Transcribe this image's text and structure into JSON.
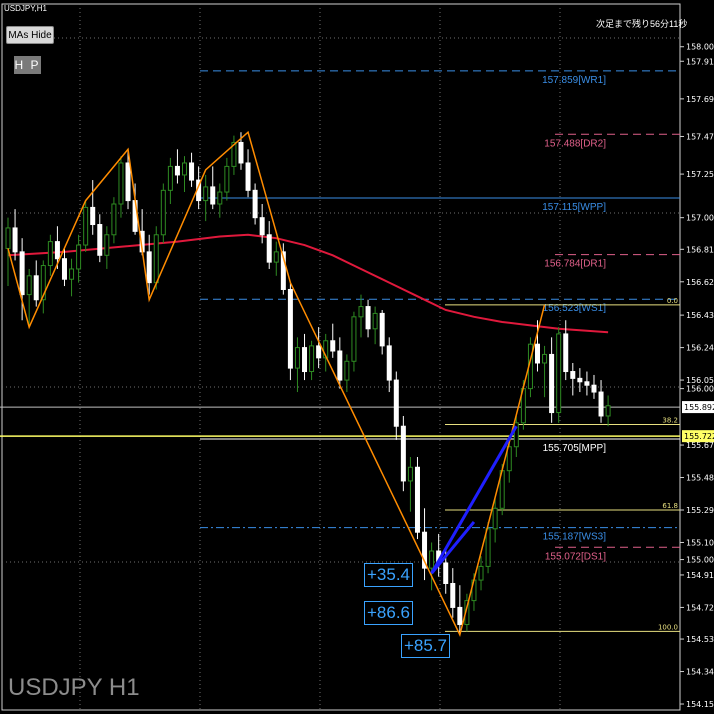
{
  "header": {
    "symbol_title": "USDJPY,H1",
    "countdown": "次足まで残り56分11秒",
    "watermark": "USDJPY H1",
    "mas_hide_label": "MAs Hide",
    "hp_label": "H P"
  },
  "gain_labels": [
    "+35.4",
    "+86.6",
    "+85.7"
  ],
  "colors": {
    "background": "#000000",
    "bull_candle": "#2e8b22",
    "bear_candle": "#ffffff",
    "moving_average": "#e0193c",
    "zigzag": "#ff8c00",
    "blue_trendlines": "#1f1fff",
    "pivot_blue": "#3a8ee6",
    "pivot_pink": "#e0608a",
    "current_price": "#ffff66"
  },
  "chart_data": {
    "type": "candlestick",
    "symbol": "USDJPY",
    "timeframe": "H1",
    "y_range": [
      154.12,
      158.25
    ],
    "y_ticks": [
      "158.000",
      "157.915",
      "157.695",
      "157.475",
      "157.255",
      "157.000",
      "156.815",
      "156.625",
      "156.430",
      "156.240",
      "156.050",
      "156.000",
      "155.670",
      "155.480",
      "155.290",
      "155.100",
      "155.000",
      "154.910",
      "154.720",
      "154.535",
      "154.345",
      "154.155"
    ],
    "price_marks": [
      {
        "text": "155.892",
        "kind": "bid"
      },
      {
        "text": "155.722",
        "kind": "current"
      }
    ],
    "pivot_levels": [
      {
        "price": 157.859,
        "label": "157.859[WR1]",
        "color": "#3a8ee6",
        "style": "dash"
      },
      {
        "price": 157.488,
        "label": "157.488[DR2]",
        "color": "#e0608a",
        "style": "dash"
      },
      {
        "price": 157.115,
        "label": "157.115[WPP]",
        "color": "#3a8ee6",
        "style": "solid"
      },
      {
        "price": 156.784,
        "label": "156.784[DR1]",
        "color": "#e0608a",
        "style": "dash"
      },
      {
        "price": 156.523,
        "label": "156.523[WS1]",
        "color": "#3a8ee6",
        "style": "dash"
      },
      {
        "price": 155.705,
        "label": "155.705[MPP]",
        "color": "#ffffff",
        "style": "solid"
      },
      {
        "price": 155.187,
        "label": "155.187[WS3]",
        "color": "#3a8ee6",
        "style": "dashdot"
      },
      {
        "price": 155.072,
        "label": "155.072[DS1]",
        "color": "#e0608a",
        "style": "dash"
      }
    ],
    "fib_levels": [
      {
        "price": 156.49,
        "label": "0.0"
      },
      {
        "price": 155.79,
        "label": "38.2"
      },
      {
        "price": 155.29,
        "label": "61.8"
      },
      {
        "price": 154.58,
        "label": "100.0"
      }
    ],
    "candles": [
      [
        156.82,
        157.0,
        156.6,
        156.94
      ],
      [
        156.94,
        157.05,
        156.75,
        156.8
      ],
      [
        156.8,
        156.88,
        156.4,
        156.55
      ],
      [
        156.55,
        156.7,
        156.36,
        156.66
      ],
      [
        156.66,
        156.75,
        156.48,
        156.52
      ],
      [
        156.52,
        156.75,
        156.44,
        156.72
      ],
      [
        156.72,
        156.9,
        156.66,
        156.86
      ],
      [
        156.86,
        156.95,
        156.7,
        156.76
      ],
      [
        156.76,
        156.82,
        156.6,
        156.64
      ],
      [
        156.64,
        156.76,
        156.54,
        156.7
      ],
      [
        156.7,
        156.9,
        156.62,
        156.84
      ],
      [
        156.84,
        157.1,
        156.8,
        157.06
      ],
      [
        157.06,
        157.22,
        156.9,
        156.96
      ],
      [
        156.96,
        157.02,
        156.74,
        156.78
      ],
      [
        156.78,
        156.95,
        156.7,
        156.9
      ],
      [
        156.9,
        157.12,
        156.85,
        157.08
      ],
      [
        157.08,
        157.36,
        157.0,
        157.32
      ],
      [
        157.32,
        157.4,
        157.05,
        157.1
      ],
      [
        157.1,
        157.2,
        156.9,
        156.92
      ],
      [
        156.92,
        157.05,
        156.78,
        156.8
      ],
      [
        156.8,
        156.9,
        156.55,
        156.62
      ],
      [
        156.62,
        156.95,
        156.58,
        156.9
      ],
      [
        156.9,
        157.2,
        156.85,
        157.16
      ],
      [
        157.16,
        157.35,
        157.08,
        157.3
      ],
      [
        157.3,
        157.4,
        157.2,
        157.25
      ],
      [
        157.25,
        157.36,
        157.15,
        157.32
      ],
      [
        157.32,
        157.38,
        157.18,
        157.22
      ],
      [
        157.22,
        157.3,
        157.05,
        157.1
      ],
      [
        157.1,
        157.25,
        156.98,
        157.18
      ],
      [
        157.18,
        157.3,
        157.05,
        157.08
      ],
      [
        157.08,
        157.2,
        157.0,
        157.15
      ],
      [
        157.15,
        157.35,
        157.1,
        157.3
      ],
      [
        157.3,
        157.48,
        157.25,
        157.44
      ],
      [
        157.44,
        157.5,
        157.28,
        157.32
      ],
      [
        157.32,
        157.4,
        157.12,
        157.16
      ],
      [
        157.16,
        157.2,
        156.96,
        157.0
      ],
      [
        157.0,
        157.08,
        156.85,
        156.9
      ],
      [
        156.9,
        156.98,
        156.7,
        156.74
      ],
      [
        156.74,
        156.86,
        156.66,
        156.8
      ],
      [
        156.8,
        156.85,
        156.55,
        156.58
      ],
      [
        156.58,
        156.62,
        156.05,
        156.12
      ],
      [
        156.12,
        156.3,
        155.98,
        156.24
      ],
      [
        156.24,
        156.32,
        156.05,
        156.1
      ],
      [
        156.1,
        156.28,
        156.05,
        156.25
      ],
      [
        156.25,
        156.36,
        156.12,
        156.18
      ],
      [
        156.18,
        156.32,
        156.1,
        156.28
      ],
      [
        156.28,
        156.38,
        156.18,
        156.22
      ],
      [
        156.22,
        156.3,
        156.0,
        156.05
      ],
      [
        156.05,
        156.2,
        155.98,
        156.16
      ],
      [
        156.16,
        156.45,
        156.1,
        156.42
      ],
      [
        156.42,
        156.55,
        156.3,
        156.48
      ],
      [
        156.48,
        156.52,
        156.3,
        156.35
      ],
      [
        156.35,
        156.48,
        156.26,
        156.44
      ],
      [
        156.44,
        156.46,
        156.2,
        156.25
      ],
      [
        156.25,
        156.3,
        155.98,
        156.05
      ],
      [
        156.05,
        156.1,
        155.7,
        155.78
      ],
      [
        155.78,
        155.84,
        155.4,
        155.46
      ],
      [
        155.46,
        155.6,
        155.28,
        155.54
      ],
      [
        155.54,
        155.6,
        155.12,
        155.16
      ],
      [
        155.16,
        155.3,
        154.88,
        154.95
      ],
      [
        154.95,
        155.1,
        154.82,
        155.05
      ],
      [
        155.05,
        155.15,
        154.9,
        154.98
      ],
      [
        154.98,
        155.06,
        154.8,
        154.86
      ],
      [
        154.86,
        154.95,
        154.66,
        154.72
      ],
      [
        154.72,
        154.85,
        154.56,
        154.62
      ],
      [
        154.62,
        154.8,
        154.58,
        154.76
      ],
      [
        154.76,
        154.92,
        154.7,
        154.88
      ],
      [
        154.88,
        155.02,
        154.82,
        154.96
      ],
      [
        154.96,
        155.22,
        154.92,
        155.18
      ],
      [
        155.18,
        155.36,
        155.1,
        155.3
      ],
      [
        155.3,
        155.56,
        155.26,
        155.52
      ],
      [
        155.52,
        155.7,
        155.45,
        155.66
      ],
      [
        155.66,
        155.84,
        155.6,
        155.8
      ],
      [
        155.8,
        156.05,
        155.76,
        156.0
      ],
      [
        156.0,
        156.3,
        155.95,
        156.26
      ],
      [
        156.26,
        156.4,
        156.1,
        156.15
      ],
      [
        156.15,
        156.25,
        155.95,
        156.2
      ],
      [
        156.2,
        156.3,
        155.8,
        155.86
      ],
      [
        155.86,
        156.36,
        155.8,
        156.32
      ],
      [
        156.32,
        156.4,
        156.05,
        156.1
      ],
      [
        156.1,
        156.15,
        155.96,
        156.06
      ],
      [
        156.06,
        156.12,
        155.98,
        156.04
      ],
      [
        156.04,
        156.1,
        155.96,
        156.02
      ],
      [
        156.02,
        156.08,
        155.94,
        155.98
      ],
      [
        155.98,
        156.05,
        155.8,
        155.84
      ],
      [
        155.84,
        155.96,
        155.78,
        155.9
      ]
    ],
    "moving_average": [
      [
        0,
        156.78
      ],
      [
        8,
        156.8
      ],
      [
        16,
        156.83
      ],
      [
        24,
        156.86
      ],
      [
        30,
        156.89
      ],
      [
        34,
        156.9
      ],
      [
        38,
        156.88
      ],
      [
        42,
        156.84
      ],
      [
        46,
        156.78
      ],
      [
        50,
        156.7
      ],
      [
        54,
        156.62
      ],
      [
        58,
        156.54
      ],
      [
        62,
        156.46
      ],
      [
        66,
        156.42
      ],
      [
        70,
        156.39
      ],
      [
        74,
        156.37
      ],
      [
        78,
        156.35
      ],
      [
        85,
        156.33
      ]
    ],
    "zigzag": [
      [
        0,
        156.82
      ],
      [
        3,
        156.36
      ],
      [
        11,
        157.1
      ],
      [
        17,
        157.4
      ],
      [
        20,
        156.52
      ],
      [
        28,
        157.28
      ],
      [
        34,
        157.5
      ],
      [
        40,
        156.62
      ],
      [
        64,
        154.56
      ],
      [
        76,
        156.49
      ]
    ],
    "blue_lines": [
      [
        [
          60,
          154.92
        ],
        [
          72,
          155.78
        ]
      ],
      [
        [
          60,
          154.92
        ],
        [
          66,
          155.22
        ]
      ]
    ]
  }
}
